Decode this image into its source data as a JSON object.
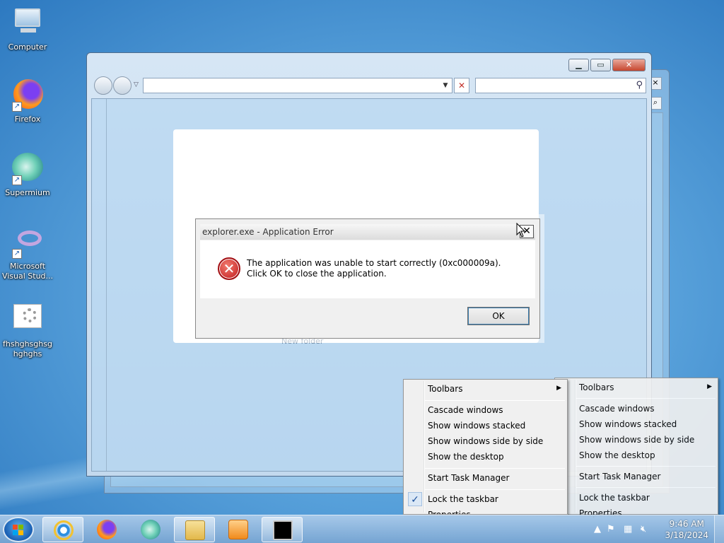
{
  "desktop": {
    "icons": [
      {
        "label": "Computer"
      },
      {
        "label": "Firefox"
      },
      {
        "label": "Supermium"
      },
      {
        "label": "Microsoft Visual Stud..."
      },
      {
        "label": "fhshghsghsg hghghs"
      }
    ]
  },
  "browser_window": {
    "address_value": "",
    "search_value": ""
  },
  "background_text": "New folder",
  "error_dialog": {
    "title": "explorer.exe - Application Error",
    "message": "The application was unable to start correctly (0xc000009a). Click OK to close the application.",
    "ok_label": "OK"
  },
  "context_menu": {
    "items": {
      "toolbars": "Toolbars",
      "cascade": "Cascade windows",
      "stacked": "Show windows stacked",
      "side_by_side": "Show windows side by side",
      "show_desktop": "Show the desktop",
      "task_manager": "Start Task Manager",
      "lock_taskbar": "Lock the taskbar",
      "properties": "Properties"
    },
    "lock_checked": true
  },
  "taskbar": {
    "pinned": [
      "internet-explorer",
      "firefox",
      "supermium",
      "file-explorer",
      "media-player",
      "command-prompt"
    ],
    "clock_time": "9:46 AM",
    "clock_date": "3/18/2024"
  }
}
